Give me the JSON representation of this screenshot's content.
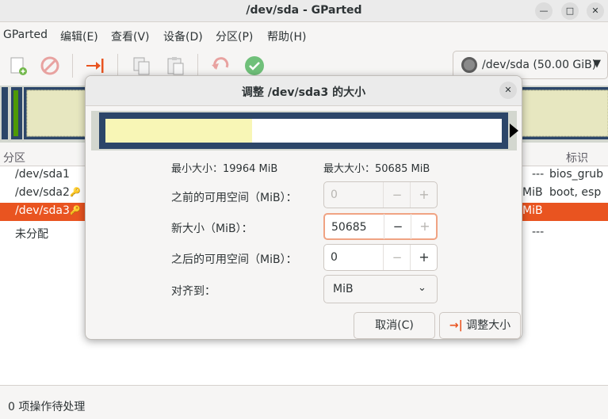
{
  "window": {
    "title": "/dev/sda - GParted"
  },
  "menubar": {
    "items": [
      "GParted",
      "编辑(E)",
      "查看(V)",
      "设备(D)",
      "分区(P)",
      "帮助(H)"
    ]
  },
  "device_selector": {
    "label": "/dev/sda (50.00 GiB)"
  },
  "columns": {
    "partition": "分区",
    "flags": "标识"
  },
  "partitions": [
    {
      "name": "/dev/sda1",
      "size_tail": "---",
      "flags": "bios_grub",
      "has_key": false
    },
    {
      "name": "/dev/sda2",
      "size_tail": "MiB",
      "flags": "boot, esp",
      "has_key": true
    },
    {
      "name": "/dev/sda3",
      "size_tail": "MiB",
      "flags": "",
      "has_key": true
    },
    {
      "name": "未分配",
      "size_tail": "---",
      "flags": "",
      "has_key": false
    }
  ],
  "status": {
    "text": "0 项操作待处理"
  },
  "dialog": {
    "title": "调整 /dev/sda3 的大小",
    "min_size": "最小大小：19964 MiB",
    "max_size": "最大大小：50685 MiB",
    "used_fraction": 0.37,
    "free_before": {
      "label": "之前的可用空间（MiB）：",
      "value": "0"
    },
    "new_size": {
      "label": "新大小（MiB）：",
      "value": "50685"
    },
    "free_after": {
      "label": "之后的可用空间（MiB）：",
      "value": "0"
    },
    "align": {
      "label": "对齐到：",
      "value": "MiB"
    },
    "cancel_label": "取消(C)",
    "resize_label": "调整大小"
  },
  "colors": {
    "accent": "#e95420",
    "partition_frame": "#2c4669",
    "used_fill": "#f8f6b6"
  }
}
